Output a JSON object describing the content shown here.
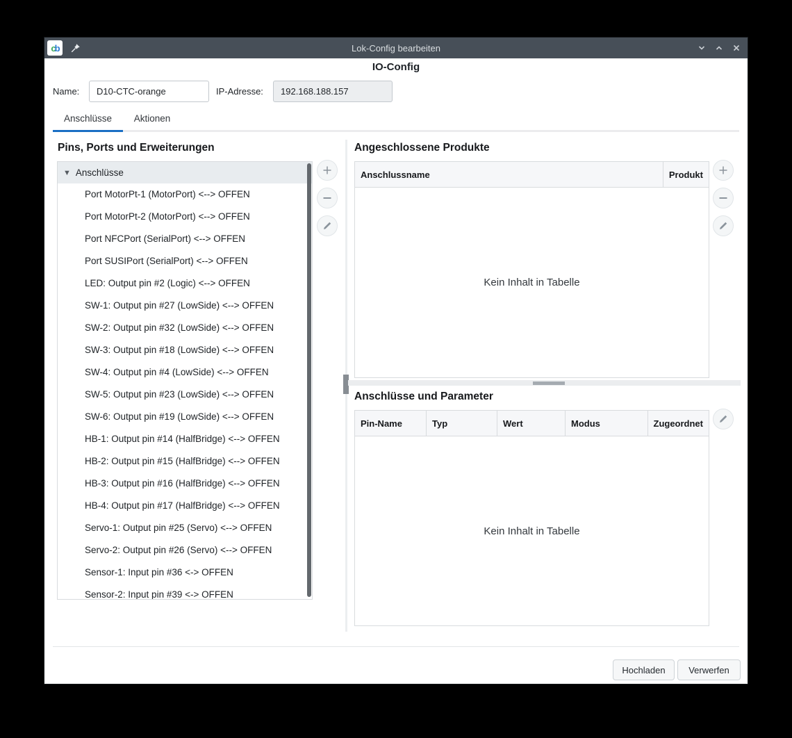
{
  "window": {
    "title": "Lok-Config bearbeiten",
    "app_icon_letters": {
      "c": "c",
      "b": "b"
    }
  },
  "header": {
    "title": "IO-Config"
  },
  "form": {
    "name_label": "Name:",
    "name_value": "D10-CTC-orange",
    "ip_label": "IP-Adresse:",
    "ip_value": "192.168.188.157"
  },
  "tabs": [
    {
      "label": "Anschlüsse",
      "active": true
    },
    {
      "label": "Aktionen",
      "active": false
    }
  ],
  "left_panel": {
    "title": "Pins, Ports und Erweiterungen",
    "tree_root": "Anschlüsse",
    "items": [
      "Port MotorPt-1 (MotorPort) <--> OFFEN",
      "Port MotorPt-2 (MotorPort) <--> OFFEN",
      "Port NFCPort (SerialPort) <--> OFFEN",
      "Port SUSIPort (SerialPort) <--> OFFEN",
      "LED: Output pin #2 (Logic) <--> OFFEN",
      "SW-1: Output pin #27 (LowSide) <--> OFFEN",
      "SW-2: Output pin #32 (LowSide) <--> OFFEN",
      "SW-3: Output pin #18 (LowSide) <--> OFFEN",
      "SW-4: Output pin #4 (LowSide) <--> OFFEN",
      "SW-5: Output pin #23 (LowSide) <--> OFFEN",
      "SW-6: Output pin #19 (LowSide) <--> OFFEN",
      "HB-1: Output pin #14 (HalfBridge) <--> OFFEN",
      "HB-2: Output pin #15 (HalfBridge) <--> OFFEN",
      "HB-3: Output pin #16 (HalfBridge) <--> OFFEN",
      "HB-4: Output pin #17 (HalfBridge) <--> OFFEN",
      "Servo-1: Output pin #25 (Servo) <--> OFFEN",
      "Servo-2: Output pin #26 (Servo) <--> OFFEN",
      "Sensor-1: Input pin #36 <-> OFFEN",
      "Sensor-2: Input pin #39 <-> OFFEN"
    ]
  },
  "products_panel": {
    "title": "Angeschlossene Produkte",
    "columns": [
      "Anschlussname",
      "Produkt"
    ],
    "empty_text": "Kein Inhalt in Tabelle"
  },
  "params_panel": {
    "title": "Anschlüsse und Parameter",
    "columns": [
      "Pin-Name",
      "Typ",
      "Wert",
      "Modus",
      "Zugeordnet"
    ],
    "empty_text": "Kein Inhalt in Tabelle"
  },
  "footer": {
    "upload_label": "Hochladen",
    "discard_label": "Verwerfen"
  },
  "colors": {
    "titlebar": "#474f58",
    "accent_tab_underline": "#1a6fc4",
    "table_header_bg": "#f6f7f9",
    "tree_header_bg": "#e8ecef",
    "border": "#d8dbde"
  }
}
